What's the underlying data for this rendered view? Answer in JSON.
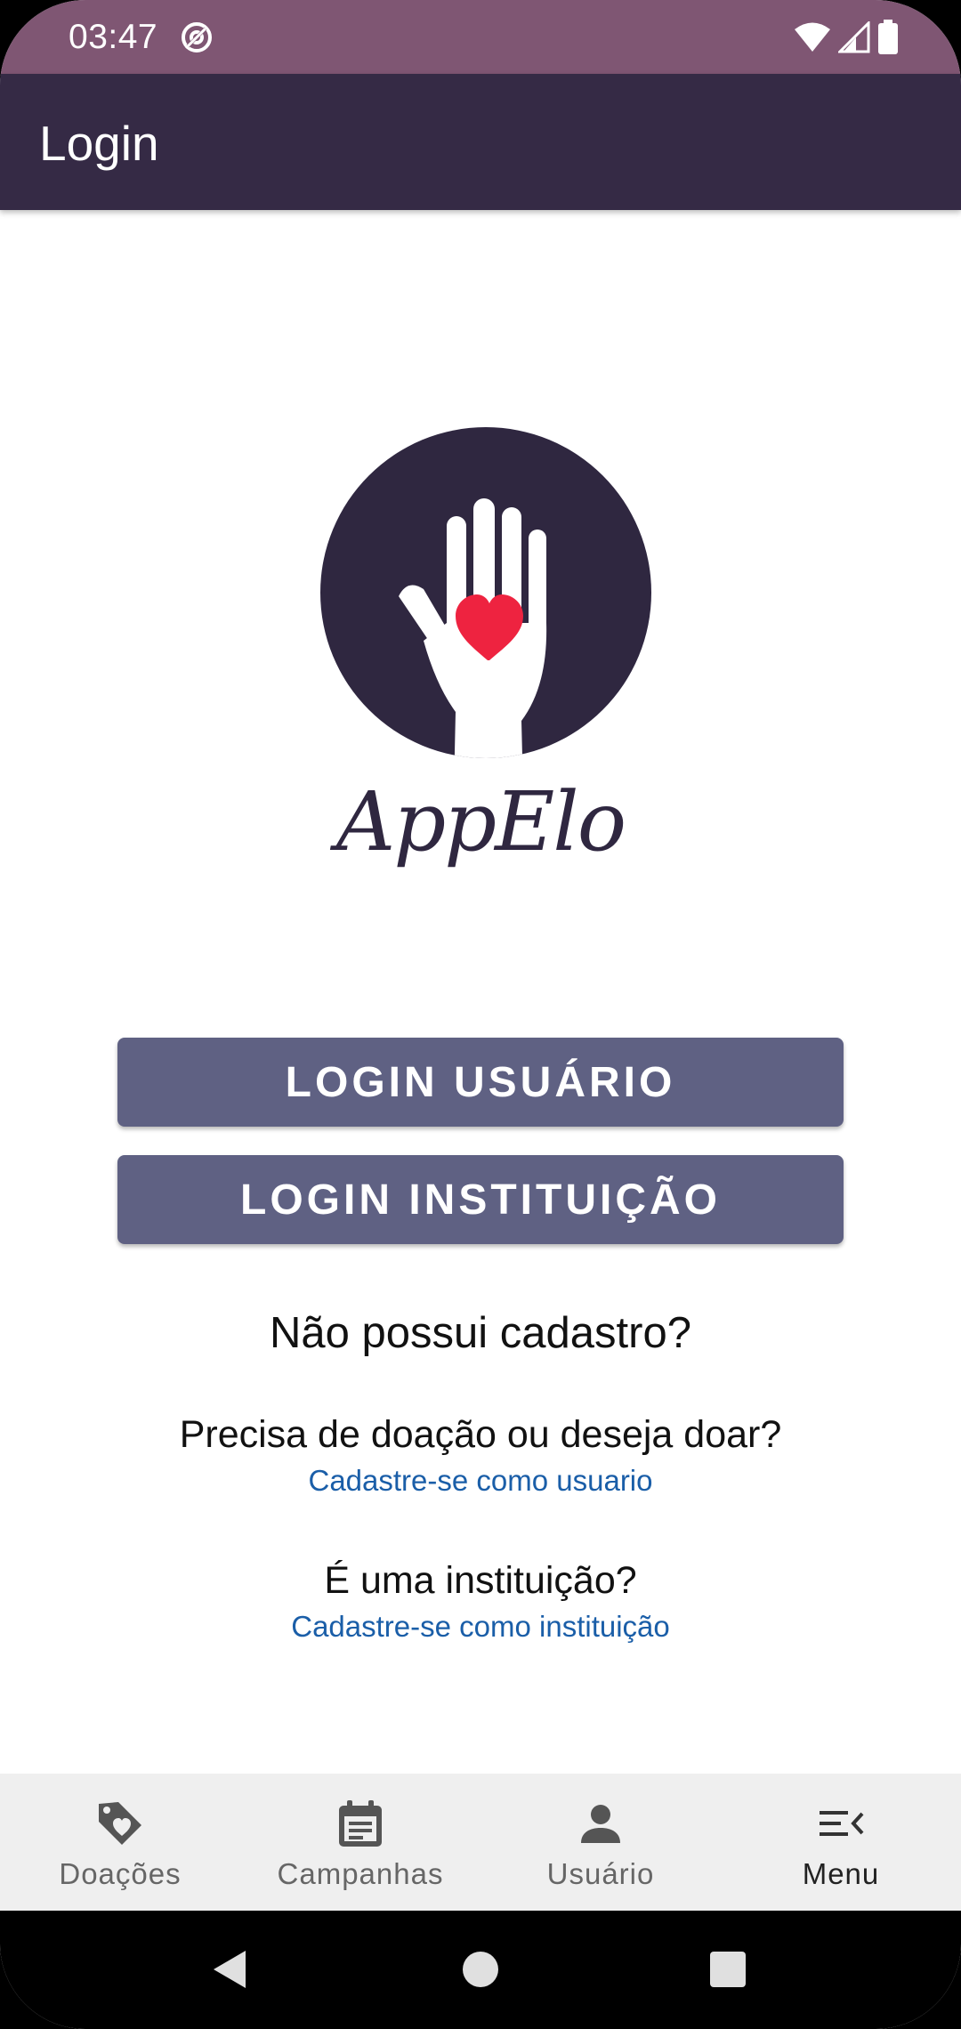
{
  "status_bar": {
    "time": "03:47",
    "icons": [
      "at-sign-icon",
      "wifi-icon",
      "signal-icon",
      "battery-icon"
    ]
  },
  "app_bar": {
    "title": "Login"
  },
  "logo": {
    "text": "AppElo",
    "icon": "hand-heart-logo"
  },
  "buttons": {
    "login_user": "LOGIN USUÁRIO",
    "login_institution": "LOGIN INSTITUIÇÃO"
  },
  "signup": {
    "question": "Não possui cadastro?",
    "user_prompt": "Precisa de doação ou deseja doar?",
    "user_link": "Cadastre-se como usuario",
    "institution_prompt": "É uma instituição?",
    "institution_link": "Cadastre-se como instituição"
  },
  "bottom_nav": {
    "items": [
      {
        "label": "Doações",
        "icon": "heart-tag-icon"
      },
      {
        "label": "Campanhas",
        "icon": "calendar-icon"
      },
      {
        "label": "Usuário",
        "icon": "person-icon"
      },
      {
        "label": "Menu",
        "icon": "menu-open-icon",
        "active": true
      }
    ]
  },
  "colors": {
    "status_bar": "#7f5673",
    "app_bar": "#352a45",
    "button": "#5f6183",
    "link": "#1a5ea8",
    "heart": "#ee2340"
  }
}
